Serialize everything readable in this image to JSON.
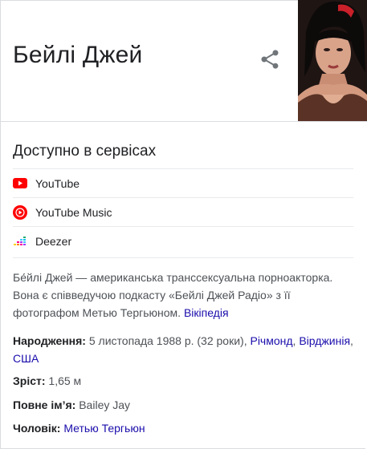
{
  "header": {
    "title": "Бейлі Джей",
    "share_icon": "share-icon"
  },
  "services": {
    "title": "Доступно в сервісах",
    "items": [
      {
        "label": "YouTube",
        "icon": "youtube-icon",
        "color": "#ff0000"
      },
      {
        "label": "YouTube Music",
        "icon": "youtube-music-icon",
        "color": "#ff0000"
      },
      {
        "label": "Deezer",
        "icon": "deezer-icon",
        "color": "#a238ff"
      }
    ]
  },
  "description": {
    "text": "Бе́йлі Джей — американська транссексуальна порноакторка. Вона є співведучою подкасту «Бейлі Джей Радіо» з її фотографом Метью Тергьюном.",
    "link": "Вікіпедія"
  },
  "facts": {
    "birth_label": "Народження:",
    "birth_value": "5 листопада 1988 р. (32 роки),",
    "birth_place_1": "Річмонд",
    "birth_sep_1": ",",
    "birth_place_2": "Вірджинія",
    "birth_sep_2": ",",
    "birth_place_3": "США",
    "height_label": "Зріст:",
    "height_value": "1,65 м",
    "fullname_label": "Повне ім’я:",
    "fullname_value": "Bailey Jay",
    "husband_label": "Чоловік:",
    "husband_value": "Метью Тергьюн"
  }
}
